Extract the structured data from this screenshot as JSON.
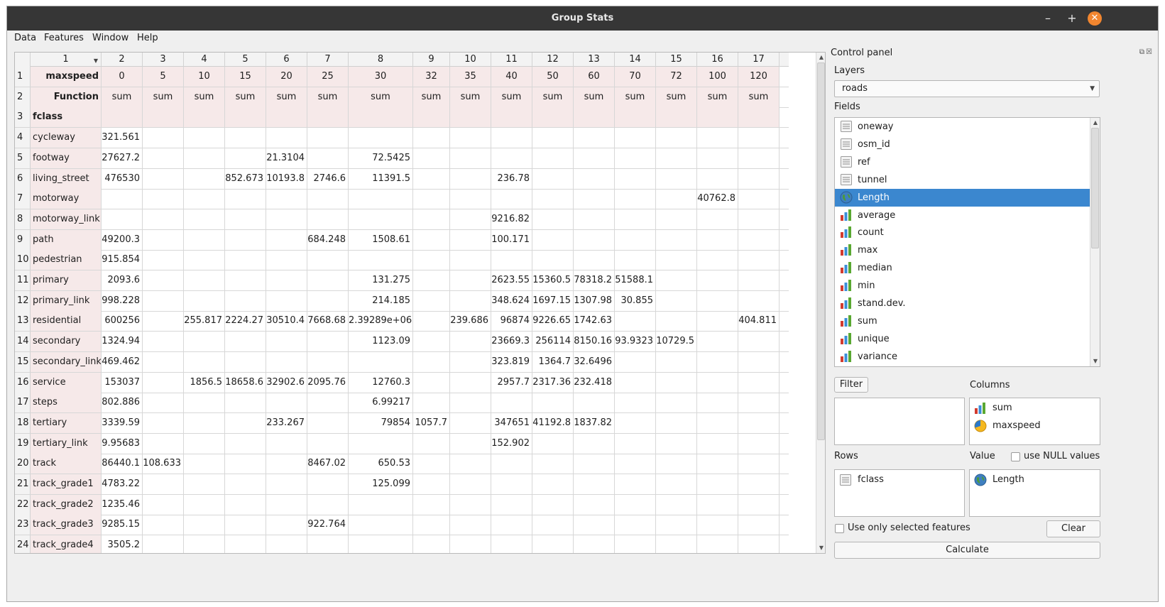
{
  "window": {
    "title": "Group Stats",
    "controls": {
      "minimize": "–",
      "maximize": "+",
      "close": "✕"
    }
  },
  "menu": [
    "Data",
    "Features",
    "Window",
    "Help"
  ],
  "table": {
    "column_headers": [
      "1",
      "2",
      "3",
      "4",
      "5",
      "6",
      "7",
      "8",
      "9",
      "10",
      "11",
      "12",
      "13",
      "14",
      "15",
      "16",
      "17"
    ],
    "header_rows": [
      {
        "num": "1",
        "label": "maxspeed",
        "cells": [
          "0",
          "5",
          "10",
          "15",
          "20",
          "25",
          "30",
          "32",
          "35",
          "40",
          "50",
          "60",
          "70",
          "72",
          "100",
          "120"
        ]
      },
      {
        "num": "2",
        "label": "Function",
        "cells": [
          "sum",
          "sum",
          "sum",
          "sum",
          "sum",
          "sum",
          "sum",
          "sum",
          "sum",
          "sum",
          "sum",
          "sum",
          "sum",
          "sum",
          "sum",
          "sum"
        ]
      },
      {
        "num": "3",
        "label": "fclass",
        "cells": [
          "",
          "",
          "",
          "",
          "",
          "",
          "",
          "",
          "",
          "",
          "",
          "",
          "",
          "",
          "",
          ""
        ]
      }
    ],
    "data_rows": [
      {
        "num": "4",
        "label": "cycleway",
        "cells": [
          "321.561",
          "",
          "",
          "",
          "",
          "",
          "",
          "",
          "",
          "",
          "",
          "",
          "",
          "",
          "",
          ""
        ]
      },
      {
        "num": "5",
        "label": "footway",
        "cells": [
          "27627.2",
          "",
          "",
          "",
          "21.3104",
          "",
          "72.5425",
          "",
          "",
          "",
          "",
          "",
          "",
          "",
          "",
          ""
        ]
      },
      {
        "num": "6",
        "label": "living_street",
        "cells": [
          "476530",
          "",
          "",
          "852.673",
          "10193.8",
          "2746.6",
          "11391.5",
          "",
          "",
          "236.78",
          "",
          "",
          "",
          "",
          "",
          ""
        ]
      },
      {
        "num": "7",
        "label": "motorway",
        "cells": [
          "",
          "",
          "",
          "",
          "",
          "",
          "",
          "",
          "",
          "",
          "",
          "",
          "",
          "",
          "40762.8",
          ""
        ]
      },
      {
        "num": "8",
        "label": "motorway_link",
        "cells": [
          "",
          "",
          "",
          "",
          "",
          "",
          "",
          "",
          "",
          "9216.82",
          "",
          "",
          "",
          "",
          "",
          ""
        ]
      },
      {
        "num": "9",
        "label": "path",
        "cells": [
          "49200.3",
          "",
          "",
          "",
          "",
          "684.248",
          "1508.61",
          "",
          "",
          "100.171",
          "",
          "",
          "",
          "",
          "",
          ""
        ]
      },
      {
        "num": "10",
        "label": "pedestrian",
        "cells": [
          "915.854",
          "",
          "",
          "",
          "",
          "",
          "",
          "",
          "",
          "",
          "",
          "",
          "",
          "",
          "",
          ""
        ]
      },
      {
        "num": "11",
        "label": "primary",
        "cells": [
          "2093.6",
          "",
          "",
          "",
          "",
          "",
          "131.275",
          "",
          "",
          "2623.55",
          "15360.5",
          "78318.2",
          "51588.1",
          "",
          "",
          ""
        ]
      },
      {
        "num": "12",
        "label": "primary_link",
        "cells": [
          "998.228",
          "",
          "",
          "",
          "",
          "",
          "214.185",
          "",
          "",
          "348.624",
          "1697.15",
          "1307.98",
          "30.855",
          "",
          "",
          ""
        ]
      },
      {
        "num": "13",
        "label": "residential",
        "cells": [
          "600256",
          "",
          "255.817",
          "2224.27",
          "30510.4",
          "7668.68",
          "2.39289e+06",
          "",
          "239.686",
          "96874",
          "9226.65",
          "1742.63",
          "",
          "",
          "",
          "404.811"
        ]
      },
      {
        "num": "14",
        "label": "secondary",
        "cells": [
          "1324.94",
          "",
          "",
          "",
          "",
          "",
          "1123.09",
          "",
          "",
          "23669.3",
          "256114",
          "8150.16",
          "93.9323",
          "10729.5",
          "",
          ""
        ]
      },
      {
        "num": "15",
        "label": "secondary_link",
        "cells": [
          "469.462",
          "",
          "",
          "",
          "",
          "",
          "",
          "",
          "",
          "323.819",
          "1364.7",
          "32.6496",
          "",
          "",
          "",
          ""
        ]
      },
      {
        "num": "16",
        "label": "service",
        "cells": [
          "153037",
          "",
          "1856.5",
          "18658.6",
          "32902.6",
          "2095.76",
          "12760.3",
          "",
          "",
          "2957.7",
          "2317.36",
          "232.418",
          "",
          "",
          "",
          ""
        ]
      },
      {
        "num": "17",
        "label": "steps",
        "cells": [
          "802.886",
          "",
          "",
          "",
          "",
          "",
          "6.99217",
          "",
          "",
          "",
          "",
          "",
          "",
          "",
          "",
          ""
        ]
      },
      {
        "num": "18",
        "label": "tertiary",
        "cells": [
          "3339.59",
          "",
          "",
          "",
          "233.267",
          "",
          "79854",
          "1057.7",
          "",
          "347651",
          "41192.8",
          "1837.82",
          "",
          "",
          "",
          ""
        ]
      },
      {
        "num": "19",
        "label": "tertiary_link",
        "cells": [
          "9.95683",
          "",
          "",
          "",
          "",
          "",
          "",
          "",
          "",
          "152.902",
          "",
          "",
          "",
          "",
          "",
          ""
        ]
      },
      {
        "num": "20",
        "label": "track",
        "cells": [
          "86440.1",
          "108.633",
          "",
          "",
          "",
          "8467.02",
          "650.53",
          "",
          "",
          "",
          "",
          "",
          "",
          "",
          "",
          ""
        ]
      },
      {
        "num": "21",
        "label": "track_grade1",
        "cells": [
          "4783.22",
          "",
          "",
          "",
          "",
          "",
          "125.099",
          "",
          "",
          "",
          "",
          "",
          "",
          "",
          "",
          ""
        ]
      },
      {
        "num": "22",
        "label": "track_grade2",
        "cells": [
          "1235.46",
          "",
          "",
          "",
          "",
          "",
          "",
          "",
          "",
          "",
          "",
          "",
          "",
          "",
          "",
          ""
        ]
      },
      {
        "num": "23",
        "label": "track_grade3",
        "cells": [
          "9285.15",
          "",
          "",
          "",
          "",
          "922.764",
          "",
          "",
          "",
          "",
          "",
          "",
          "",
          "",
          "",
          ""
        ]
      },
      {
        "num": "24",
        "label": "track_grade4",
        "cells": [
          "3505.2",
          "",
          "",
          "",
          "",
          "",
          "",
          "",
          "",
          "",
          "",
          "",
          "",
          "",
          "",
          ""
        ]
      }
    ]
  },
  "control_panel": {
    "title": "Control panel",
    "layers_label": "Layers",
    "layer_value": "roads",
    "fields_label": "Fields",
    "fields": [
      {
        "name": "oneway",
        "icon": "text-field-icon"
      },
      {
        "name": "osm_id",
        "icon": "text-field-icon"
      },
      {
        "name": "ref",
        "icon": "text-field-icon"
      },
      {
        "name": "tunnel",
        "icon": "text-field-icon"
      },
      {
        "name": "Length",
        "icon": "globe-icon",
        "selected": true
      },
      {
        "name": "average",
        "icon": "bar-chart-icon"
      },
      {
        "name": "count",
        "icon": "bar-chart-icon"
      },
      {
        "name": "max",
        "icon": "bar-chart-icon"
      },
      {
        "name": "median",
        "icon": "bar-chart-icon"
      },
      {
        "name": "min",
        "icon": "bar-chart-icon"
      },
      {
        "name": "stand.dev.",
        "icon": "bar-chart-icon"
      },
      {
        "name": "sum",
        "icon": "bar-chart-icon"
      },
      {
        "name": "unique",
        "icon": "bar-chart-icon"
      },
      {
        "name": "variance",
        "icon": "bar-chart-icon"
      }
    ],
    "filter_label": "Filter",
    "columns_label": "Columns",
    "columns": [
      {
        "name": "sum",
        "icon": "bar-chart-icon"
      },
      {
        "name": "maxspeed",
        "icon": "pie-chart-icon"
      }
    ],
    "rows_label": "Rows",
    "rows": [
      {
        "name": "fclass",
        "icon": "text-field-icon"
      }
    ],
    "value_label": "Value",
    "null_label": "use NULL values",
    "value": [
      {
        "name": "Length",
        "icon": "globe-icon"
      }
    ],
    "selected_only_label": "Use only selected features",
    "clear_label": "Clear",
    "calculate_label": "Calculate"
  },
  "colors": {
    "titlebar": "#363636",
    "close_button": "#f2862f",
    "header_cell_bg": "#f6e9e9",
    "selection": "#3b87cf"
  }
}
